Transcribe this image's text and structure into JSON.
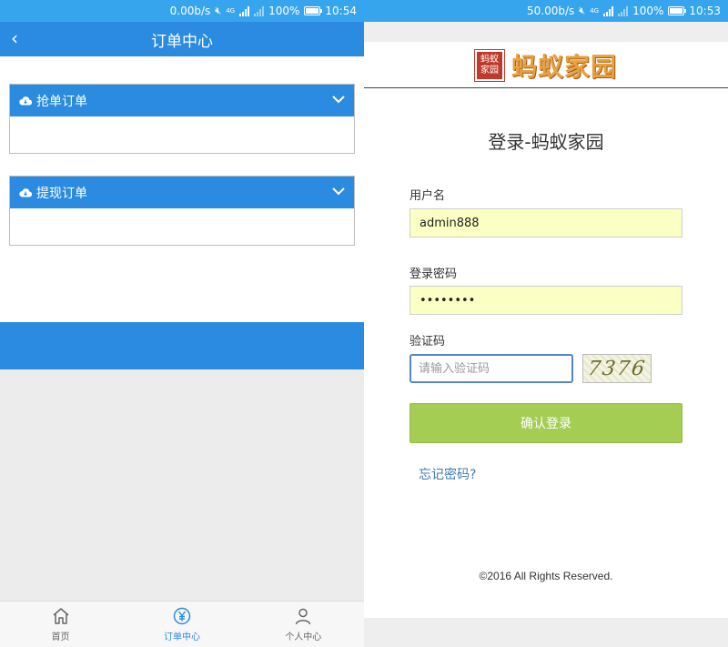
{
  "order_screen": {
    "status_bar": {
      "speed": "0.00b/s",
      "network": "4G",
      "battery": "100%",
      "time": "10:54"
    },
    "header": {
      "back_icon": "chevron-left-icon",
      "title": "订单中心"
    },
    "panels": [
      {
        "title": "抢单订单",
        "icon": "cloud-download-icon",
        "toggle_icon": "chevron-down-icon"
      },
      {
        "title": "提现订单",
        "icon": "cloud-download-icon",
        "toggle_icon": "chevron-down-icon"
      }
    ],
    "tabs": [
      {
        "label": "首页",
        "icon": "home-icon",
        "active": false
      },
      {
        "label": "订单中心",
        "icon": "yen-circle-icon",
        "active": true
      },
      {
        "label": "个人中心",
        "icon": "user-icon",
        "active": false
      }
    ],
    "colors": {
      "primary": "#2b8be0",
      "status_bar": "#37a5ee"
    }
  },
  "login_screen": {
    "status_bar": {
      "speed": "50.00b/s",
      "network": "4G",
      "battery": "100%",
      "time": "10:53"
    },
    "logo": {
      "mark_text": "蚂蚁家园",
      "text": "蚂蚁家园"
    },
    "heading": "登录-蚂蚁家园",
    "username": {
      "label": "用户名",
      "value": "admin888"
    },
    "password": {
      "label": "登录密码",
      "value": "••••••••"
    },
    "captcha": {
      "label": "验证码",
      "placeholder": "请输入验证码",
      "image_text": "7376"
    },
    "submit_label": "确认登录",
    "forgot_label": "忘记密码?",
    "footer": "©2016 All Rights Reserved.",
    "colors": {
      "input_fill": "#fcffc4",
      "button": "#a4cd54",
      "link": "#3a7bb5"
    }
  }
}
